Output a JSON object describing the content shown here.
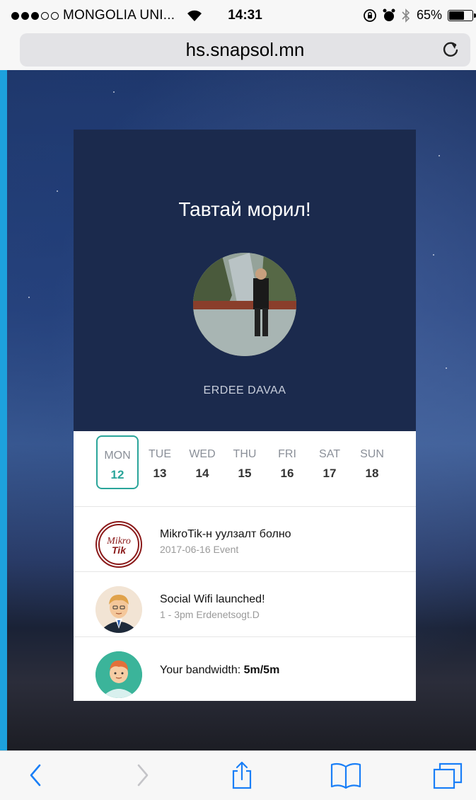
{
  "status_bar": {
    "carrier": "MONGOLIA UNI...",
    "time": "14:31",
    "battery": "65%",
    "battery_level": 0.65
  },
  "browser": {
    "url": "hs.snapsol.mn"
  },
  "card": {
    "greeting": "Тавтай морил!",
    "user_name": "ERDEE DAVAA",
    "days": [
      {
        "name": "MON",
        "num": "12"
      },
      {
        "name": "TUE",
        "num": "13"
      },
      {
        "name": "WED",
        "num": "14"
      },
      {
        "name": "THU",
        "num": "15"
      },
      {
        "name": "FRI",
        "num": "16"
      },
      {
        "name": "SAT",
        "num": "17"
      },
      {
        "name": "SUN",
        "num": "18"
      }
    ],
    "items": [
      {
        "title": "MikroTik-н уулзалт болно",
        "sub": "2017-06-16 Event",
        "logo_text_1": "Mikro",
        "logo_text_2": "Tik"
      },
      {
        "title": "Social Wifi launched!",
        "sub": "1 - 3pm Erdenetsogt.D"
      },
      {
        "title_prefix": "Your bandwidth: ",
        "title_value": "5m/5m"
      }
    ]
  },
  "colors": {
    "accent": "#2aa59a",
    "card_header": "#1b2a4d",
    "ios_blue": "#1a7ff7"
  }
}
